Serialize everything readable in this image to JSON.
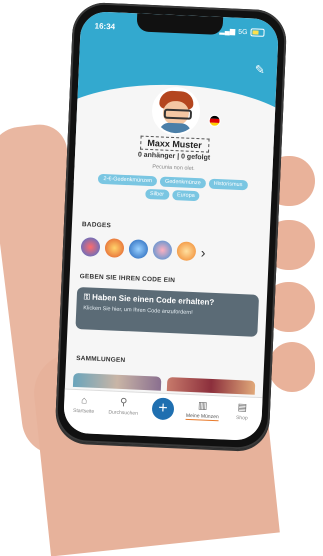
{
  "status": {
    "time": "16:34",
    "signal": "5G"
  },
  "profile": {
    "username": "Maxx Muster",
    "followers": "0 anhänger | 0 gefolgt",
    "quote": "Pecunia non olet.",
    "tags": [
      "2-€-Gedenkmünzen",
      "Gedenkmünze",
      "Historismus",
      "Silber",
      "Europa"
    ]
  },
  "badges": {
    "title": "BADGES"
  },
  "code": {
    "section_title": "GEBEN SIE IHREN CODE EIN",
    "card_title": "Haben Sie einen Code erhalten?",
    "card_subtitle": "Klicken Sie hier, um Ihren Code anzufordern!"
  },
  "collections": {
    "title": "SAMMLUNGEN"
  },
  "tabs": [
    {
      "label": "Startseite",
      "icon": "home-icon",
      "glyph": "⌂"
    },
    {
      "label": "Durchsuchen",
      "icon": "search-coins-icon",
      "glyph": "⚲"
    },
    {
      "label": "",
      "icon": "plus-icon",
      "glyph": "+"
    },
    {
      "label": "Meine Münzen",
      "icon": "coins-icon",
      "glyph": "▥"
    },
    {
      "label": "Shop",
      "icon": "shop-icon",
      "glyph": "▤"
    }
  ],
  "colors": {
    "header": "#33a9cf",
    "tag": "#7ac6e2",
    "card": "#5b6b76",
    "fab": "#1f6fb0"
  }
}
